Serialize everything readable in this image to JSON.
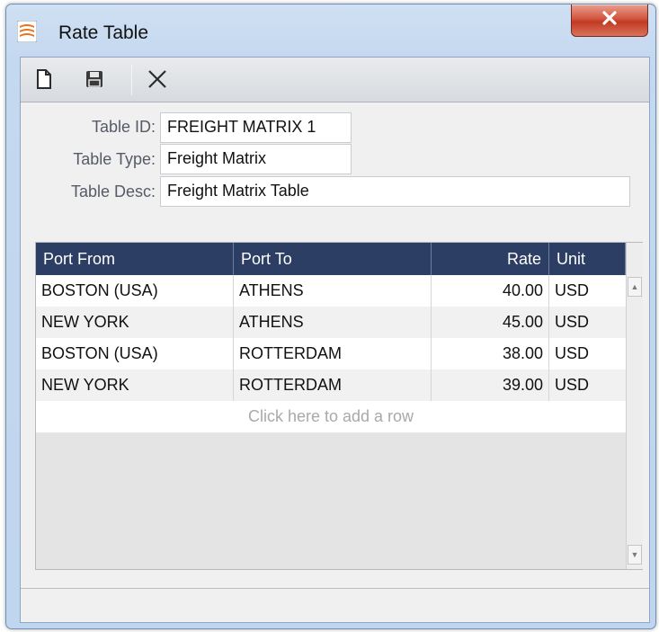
{
  "window": {
    "title": "Rate Table",
    "app_icon": "stack-layers-icon",
    "close_icon": "close-x-icon",
    "accent_color": "#d2553f"
  },
  "toolbar": {
    "buttons": [
      {
        "name": "new",
        "icon": "new-document-icon"
      },
      {
        "name": "save",
        "icon": "save-disk-icon"
      },
      {
        "name": "delete",
        "icon": "delete-x-icon"
      }
    ]
  },
  "form": {
    "table_id_label": "Table ID:",
    "table_id_value": "FREIGHT MATRIX 1",
    "table_type_label": "Table Type:",
    "table_type_value": "Freight Matrix",
    "table_desc_label": "Table Desc:",
    "table_desc_value": "Freight Matrix Table"
  },
  "grid": {
    "header_color": "#2c3e63",
    "columns": [
      "Port From",
      "Port To",
      "Rate",
      "Unit"
    ],
    "rows": [
      {
        "port_from": "BOSTON (USA)",
        "port_to": "ATHENS",
        "rate": "40.00",
        "unit": "USD"
      },
      {
        "port_from": "NEW YORK",
        "port_to": "ATHENS",
        "rate": "45.00",
        "unit": "USD"
      },
      {
        "port_from": "BOSTON (USA)",
        "port_to": "ROTTERDAM",
        "rate": "38.00",
        "unit": "USD"
      },
      {
        "port_from": "NEW YORK",
        "port_to": "ROTTERDAM",
        "rate": "39.00",
        "unit": "USD"
      }
    ],
    "add_row_text": "Click here to add a row"
  }
}
